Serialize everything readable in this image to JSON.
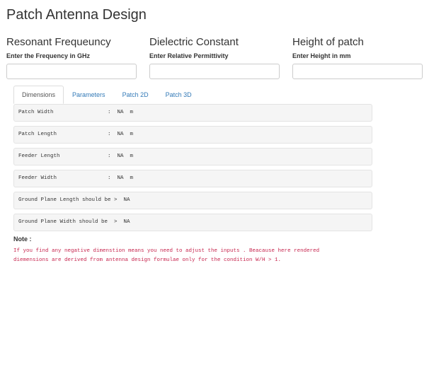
{
  "page": {
    "title": "Patch Antenna Design"
  },
  "inputs": [
    {
      "heading": "Resonant Frequeuncy",
      "label": "Enter the Frequency in GHz",
      "value": "",
      "placeholder": ""
    },
    {
      "heading": "Dielectric Constant",
      "label": "Enter Relative Permittivity",
      "value": "",
      "placeholder": ""
    },
    {
      "heading": "Height of patch",
      "label": "Enter Height in mm",
      "value": "",
      "placeholder": ""
    }
  ],
  "tabs": [
    {
      "label": "Dimensions",
      "active": true
    },
    {
      "label": "Parameters",
      "active": false
    },
    {
      "label": "Patch 2D",
      "active": false
    },
    {
      "label": "Patch 3D",
      "active": false
    }
  ],
  "outputs": [
    {
      "text": "Patch Width                 :  NA  m"
    },
    {
      "text": "Patch Length                :  NA  m"
    },
    {
      "text": "Feeder Length               :  NA  m"
    },
    {
      "text": "Feeder Width                :  NA  m"
    },
    {
      "text": "Ground Plane Length should be >  NA"
    },
    {
      "text": "Ground Plane Width should be  >  NA"
    }
  ],
  "note": {
    "label": "Note :",
    "line1": "If you find any negative dimenstion means you need to adjust the inputs . Beacause here rendered",
    "line2": "diemensions are derived from antenna design formulae only for the condition W/H > 1."
  }
}
